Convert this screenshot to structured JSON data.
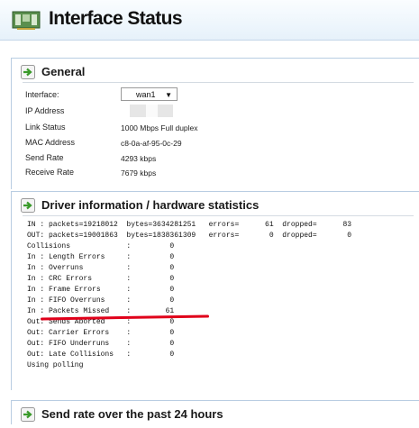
{
  "header": {
    "title": "Interface Status",
    "icon": "network-card-icon"
  },
  "general": {
    "title": "General",
    "icon": "arrow-right-icon",
    "rows": [
      {
        "label": "Interface:",
        "value": "wan1"
      },
      {
        "label": "IP Address",
        "value": ""
      },
      {
        "label": "Link Status",
        "value": "1000 Mbps Full duplex"
      },
      {
        "label": "MAC Address",
        "value": "c8-0a-af-95-0c-29"
      },
      {
        "label": "Send Rate",
        "value": "4293 kbps"
      },
      {
        "label": "Receive Rate",
        "value": "7679 kbps"
      }
    ]
  },
  "driver": {
    "title": "Driver information / hardware statistics",
    "icon": "arrow-right-icon",
    "lines": [
      "IN : packets=19218012  bytes=3634281251   errors=      61  dropped=      83",
      "OUT: packets=19001863  bytes=1838361309   errors=       0  dropped=       0",
      "Collisions             :         0",
      "In : Length Errors     :         0",
      "In : Overruns          :         0",
      "In : CRC Errors        :         0",
      "In : Frame Errors      :         0",
      "In : FIFO Overruns     :         0",
      "In : Packets Missed    :        61",
      "Out: Sends Aborted     :         0",
      "Out: Carrier Errors    :         0",
      "Out: FIFO Underruns    :         0",
      "Out: Late Collisions   :         0",
      "Using polling"
    ],
    "highlight_color": "#e0001a"
  },
  "rate_section": {
    "title": "Send rate over the past 24 hours",
    "icon": "arrow-right-icon"
  }
}
